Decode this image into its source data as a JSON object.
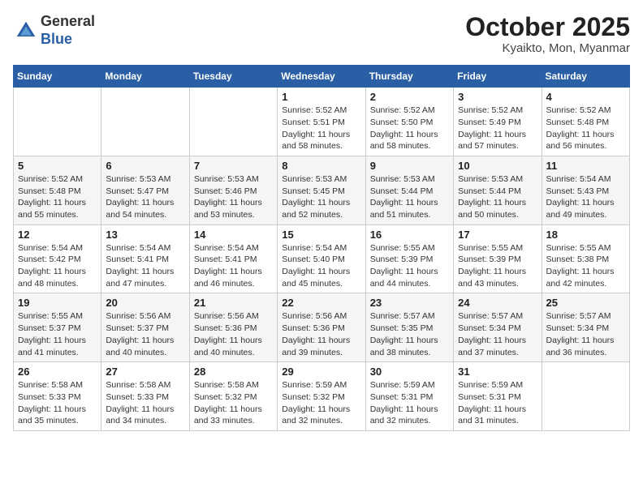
{
  "header": {
    "logo_general": "General",
    "logo_blue": "Blue",
    "month_title": "October 2025",
    "location": "Kyaikto, Mon, Myanmar"
  },
  "weekdays": [
    "Sunday",
    "Monday",
    "Tuesday",
    "Wednesday",
    "Thursday",
    "Friday",
    "Saturday"
  ],
  "weeks": [
    [
      {
        "day": "",
        "info": ""
      },
      {
        "day": "",
        "info": ""
      },
      {
        "day": "",
        "info": ""
      },
      {
        "day": "1",
        "info": "Sunrise: 5:52 AM\nSunset: 5:51 PM\nDaylight: 11 hours\nand 58 minutes."
      },
      {
        "day": "2",
        "info": "Sunrise: 5:52 AM\nSunset: 5:50 PM\nDaylight: 11 hours\nand 58 minutes."
      },
      {
        "day": "3",
        "info": "Sunrise: 5:52 AM\nSunset: 5:49 PM\nDaylight: 11 hours\nand 57 minutes."
      },
      {
        "day": "4",
        "info": "Sunrise: 5:52 AM\nSunset: 5:48 PM\nDaylight: 11 hours\nand 56 minutes."
      }
    ],
    [
      {
        "day": "5",
        "info": "Sunrise: 5:52 AM\nSunset: 5:48 PM\nDaylight: 11 hours\nand 55 minutes."
      },
      {
        "day": "6",
        "info": "Sunrise: 5:53 AM\nSunset: 5:47 PM\nDaylight: 11 hours\nand 54 minutes."
      },
      {
        "day": "7",
        "info": "Sunrise: 5:53 AM\nSunset: 5:46 PM\nDaylight: 11 hours\nand 53 minutes."
      },
      {
        "day": "8",
        "info": "Sunrise: 5:53 AM\nSunset: 5:45 PM\nDaylight: 11 hours\nand 52 minutes."
      },
      {
        "day": "9",
        "info": "Sunrise: 5:53 AM\nSunset: 5:44 PM\nDaylight: 11 hours\nand 51 minutes."
      },
      {
        "day": "10",
        "info": "Sunrise: 5:53 AM\nSunset: 5:44 PM\nDaylight: 11 hours\nand 50 minutes."
      },
      {
        "day": "11",
        "info": "Sunrise: 5:54 AM\nSunset: 5:43 PM\nDaylight: 11 hours\nand 49 minutes."
      }
    ],
    [
      {
        "day": "12",
        "info": "Sunrise: 5:54 AM\nSunset: 5:42 PM\nDaylight: 11 hours\nand 48 minutes."
      },
      {
        "day": "13",
        "info": "Sunrise: 5:54 AM\nSunset: 5:41 PM\nDaylight: 11 hours\nand 47 minutes."
      },
      {
        "day": "14",
        "info": "Sunrise: 5:54 AM\nSunset: 5:41 PM\nDaylight: 11 hours\nand 46 minutes."
      },
      {
        "day": "15",
        "info": "Sunrise: 5:54 AM\nSunset: 5:40 PM\nDaylight: 11 hours\nand 45 minutes."
      },
      {
        "day": "16",
        "info": "Sunrise: 5:55 AM\nSunset: 5:39 PM\nDaylight: 11 hours\nand 44 minutes."
      },
      {
        "day": "17",
        "info": "Sunrise: 5:55 AM\nSunset: 5:39 PM\nDaylight: 11 hours\nand 43 minutes."
      },
      {
        "day": "18",
        "info": "Sunrise: 5:55 AM\nSunset: 5:38 PM\nDaylight: 11 hours\nand 42 minutes."
      }
    ],
    [
      {
        "day": "19",
        "info": "Sunrise: 5:55 AM\nSunset: 5:37 PM\nDaylight: 11 hours\nand 41 minutes."
      },
      {
        "day": "20",
        "info": "Sunrise: 5:56 AM\nSunset: 5:37 PM\nDaylight: 11 hours\nand 40 minutes."
      },
      {
        "day": "21",
        "info": "Sunrise: 5:56 AM\nSunset: 5:36 PM\nDaylight: 11 hours\nand 40 minutes."
      },
      {
        "day": "22",
        "info": "Sunrise: 5:56 AM\nSunset: 5:36 PM\nDaylight: 11 hours\nand 39 minutes."
      },
      {
        "day": "23",
        "info": "Sunrise: 5:57 AM\nSunset: 5:35 PM\nDaylight: 11 hours\nand 38 minutes."
      },
      {
        "day": "24",
        "info": "Sunrise: 5:57 AM\nSunset: 5:34 PM\nDaylight: 11 hours\nand 37 minutes."
      },
      {
        "day": "25",
        "info": "Sunrise: 5:57 AM\nSunset: 5:34 PM\nDaylight: 11 hours\nand 36 minutes."
      }
    ],
    [
      {
        "day": "26",
        "info": "Sunrise: 5:58 AM\nSunset: 5:33 PM\nDaylight: 11 hours\nand 35 minutes."
      },
      {
        "day": "27",
        "info": "Sunrise: 5:58 AM\nSunset: 5:33 PM\nDaylight: 11 hours\nand 34 minutes."
      },
      {
        "day": "28",
        "info": "Sunrise: 5:58 AM\nSunset: 5:32 PM\nDaylight: 11 hours\nand 33 minutes."
      },
      {
        "day": "29",
        "info": "Sunrise: 5:59 AM\nSunset: 5:32 PM\nDaylight: 11 hours\nand 32 minutes."
      },
      {
        "day": "30",
        "info": "Sunrise: 5:59 AM\nSunset: 5:31 PM\nDaylight: 11 hours\nand 32 minutes."
      },
      {
        "day": "31",
        "info": "Sunrise: 5:59 AM\nSunset: 5:31 PM\nDaylight: 11 hours\nand 31 minutes."
      },
      {
        "day": "",
        "info": ""
      }
    ]
  ]
}
